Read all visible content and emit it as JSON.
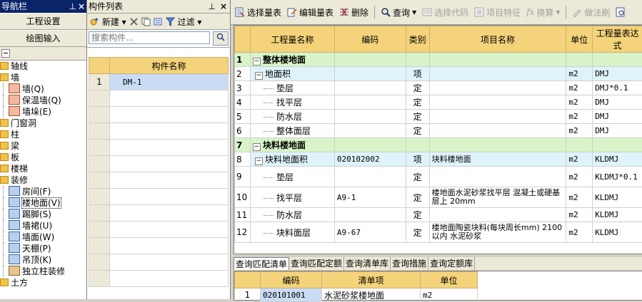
{
  "nav": {
    "title": "导航栏",
    "pin_icon": "pin-icon",
    "btn_project_settings": "工程设置",
    "btn_drawing_input": "绘图输入",
    "tree": [
      {
        "label": "轴线",
        "level": 1
      },
      {
        "label": "墙",
        "level": 1
      },
      {
        "label": "墙(Q)",
        "level": 2,
        "icon": "wall-icon"
      },
      {
        "label": "保温墙(Q)",
        "level": 2,
        "icon": "insulation-wall-icon"
      },
      {
        "label": "墙垛(E)",
        "level": 2,
        "icon": "wall-pier-icon"
      },
      {
        "label": "门窗洞",
        "level": 1
      },
      {
        "label": "柱",
        "level": 1
      },
      {
        "label": "梁",
        "level": 1
      },
      {
        "label": "板",
        "level": 1
      },
      {
        "label": "楼梯",
        "level": 1
      },
      {
        "label": "装修",
        "level": 1
      },
      {
        "label": "房间(F)",
        "level": 2,
        "icon": "room-icon"
      },
      {
        "label": "楼地面(V)",
        "level": 2,
        "icon": "floor-icon",
        "selected": true
      },
      {
        "label": "踢脚(S)",
        "level": 2,
        "icon": "skirting-icon"
      },
      {
        "label": "墙裙(U)",
        "level": 2,
        "icon": "dado-icon"
      },
      {
        "label": "墙面(W)",
        "level": 2,
        "icon": "wall-face-icon"
      },
      {
        "label": "天棚(P)",
        "level": 2,
        "icon": "ceiling-icon"
      },
      {
        "label": "吊顶(K)",
        "level": 2,
        "icon": "suspended-ceiling-icon"
      },
      {
        "label": "独立柱装修",
        "level": 2,
        "icon": "column-finish-icon"
      },
      {
        "label": "土方",
        "level": 1
      }
    ]
  },
  "comp": {
    "title": "构件列表",
    "new_label": "新建",
    "filter_label": "过滤",
    "search_placeholder": "搜索构件...",
    "col_header": "构件名称",
    "rows": [
      {
        "num": "1",
        "name": "DM-1"
      }
    ]
  },
  "main": {
    "toolbar": {
      "select_list": "选择量表",
      "edit_list": "编辑量表",
      "delete": "删除",
      "query": "查询",
      "select_code": "选择代码",
      "item_feature": "项目特征",
      "convert": "换算",
      "method": "做法刷"
    },
    "headers": [
      "工程量名称",
      "编码",
      "类别",
      "项目名称",
      "单位",
      "工程量表达式"
    ],
    "rows": [
      {
        "n": "1",
        "type": "group",
        "name": "整体楼地面",
        "code": "",
        "cat": "",
        "item": "",
        "unit": "",
        "expr": ""
      },
      {
        "n": "2",
        "type": "child",
        "name": "地面积",
        "code": "",
        "cat": "项",
        "item": "",
        "unit": "m2",
        "expr": "DMJ"
      },
      {
        "n": "3",
        "type": "leaf",
        "name": "垫层",
        "code": "",
        "cat": "定",
        "item": "",
        "unit": "m2",
        "expr": "DMJ*0.1"
      },
      {
        "n": "4",
        "type": "leaf",
        "name": "找平层",
        "code": "",
        "cat": "定",
        "item": "",
        "unit": "m2",
        "expr": "DMJ"
      },
      {
        "n": "5",
        "type": "leaf",
        "name": "防水层",
        "code": "",
        "cat": "定",
        "item": "",
        "unit": "m2",
        "expr": "DMJ"
      },
      {
        "n": "6",
        "type": "leaf",
        "name": "整体面层",
        "code": "",
        "cat": "定",
        "item": "",
        "unit": "m2",
        "expr": "DMJ"
      },
      {
        "n": "7",
        "type": "group",
        "name": "块料楼地面",
        "code": "",
        "cat": "",
        "item": "",
        "unit": "",
        "expr": ""
      },
      {
        "n": "8",
        "type": "child",
        "name": "块料地面积",
        "code": "020102002",
        "cat": "项",
        "item": "块料楼地面",
        "unit": "m2",
        "expr": "KLDMJ"
      },
      {
        "n": "9",
        "type": "leaf tall",
        "name": "垫层",
        "code": "",
        "cat": "定",
        "item": "",
        "unit": "m2",
        "expr": "KLDMJ*0.1"
      },
      {
        "n": "10",
        "type": "leaf tall",
        "name": "找平层",
        "code": "A9-1",
        "cat": "定",
        "item": "楼地面水泥砂浆找平层 混凝土或硬基层上 20mm",
        "unit": "m2",
        "expr": "KLDMJ"
      },
      {
        "n": "11",
        "type": "leaf",
        "name": "防水层",
        "code": "",
        "cat": "定",
        "item": "",
        "unit": "m2",
        "expr": "KLDMJ"
      },
      {
        "n": "12",
        "type": "leaf tall",
        "name": "块料面层",
        "code": "A9-67",
        "cat": "定",
        "item": "楼地面陶瓷块料(每块周长mm) 2100以内 水泥砂浆",
        "unit": "m2",
        "expr": "KLDMJ"
      }
    ]
  },
  "bottom": {
    "tabs": [
      "查询匹配清单",
      "查询匹配定额",
      "查询清单库",
      "查询措施",
      "查询定额库"
    ],
    "headers": [
      "编码",
      "清单项",
      "单位"
    ],
    "rows": [
      {
        "num": "1",
        "code": "020101001",
        "item": "水泥砂浆楼地面",
        "unit": "m2"
      }
    ]
  }
}
